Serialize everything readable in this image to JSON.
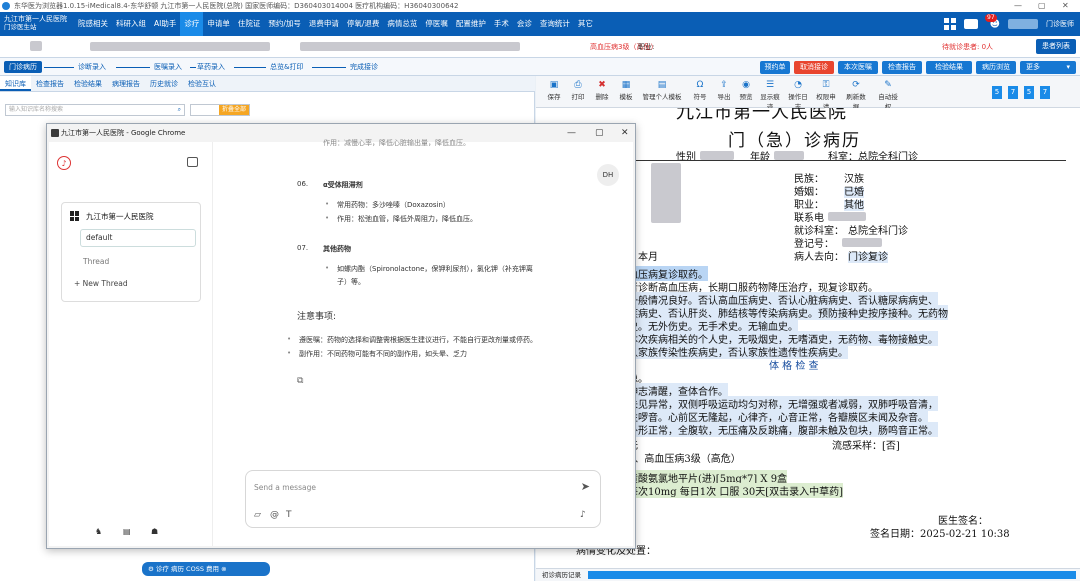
{
  "window": {
    "title": "东华医为浏览器1.0.15-iMedical8.4-东华舒顿 九江市第一人民医院(总院) 国家医师编码：D360403014004 医疗机构编码：H36040300642"
  },
  "menubar": {
    "logo_title": "九江市第一人民医院",
    "logo_sub": "门诊医生站",
    "items": [
      "院感相关",
      "科研入组",
      "AI助手",
      "诊疗",
      "申请单",
      "住院证",
      "预约/加号",
      "退费申请",
      "停氧/退费",
      "病情总览",
      "停医嘱",
      "配置维护",
      "手术",
      "会诊",
      "查询统计",
      "其它"
    ],
    "active_index": 3,
    "badge_count": "97",
    "user_label": "门诊医师"
  },
  "subbar": {
    "status": "高血压病3级（高危）",
    "job_label": "职业:",
    "waiting": "待就诊患者: 0人",
    "patient_list": "患者列表"
  },
  "flow": {
    "active": "门诊病历",
    "steps": [
      "诊断录入",
      "医嘱录入",
      "草药录入",
      "总览&打印",
      "完成接诊"
    ]
  },
  "flow_buttons": [
    "预约单",
    "取消接诊",
    "本次医嘱",
    "检查报告",
    "检验结果",
    "病历浏览",
    "更多"
  ],
  "left_tabs": [
    "知识库",
    "检查报告",
    "检验结果",
    "病理报告",
    "历史就诊",
    "检验互认"
  ],
  "left_search": {
    "placeholder": "输入知识库名称搜索",
    "toggle": "折叠全部"
  },
  "doc_toolbar": [
    "保存",
    "打印",
    "删除",
    "模板",
    "管理个人模板",
    "符号",
    "导出",
    "预览",
    "显示痕迹",
    "操作日志",
    "权限申请",
    "刷新数据",
    "自动授权"
  ],
  "doc_pages": [
    "5",
    "7",
    "5",
    "7"
  ],
  "doc": {
    "h1": "九江市第一人民医院",
    "h2": "门（急）诊病历",
    "gender_label": "性别",
    "age_label": "年龄",
    "dept": "科室：总院全科门诊",
    "nation_label": "民族：",
    "nation": "汉族",
    "marital_label": "婚姻：",
    "marital": "已婚",
    "job_label": "职业：",
    "job": "其他",
    "contact_label": "联系电",
    "clinic_label": "就诊科室：",
    "clinic": "总院全科门诊",
    "reg_label": "登记号：",
    "dest_label": "病人去向：",
    "dest": "门诊复诊",
    "l1": "：本月",
    "l2": "血压病复诊取药。",
    "l3": "者诊断高血压病，长期口服药物降压治疗，现复诊取药。",
    "l4": "一般情况良好。否认高血压病史、否认心脏病病史、否认糖尿病病史、",
    "l5": "疾病史、否认肝炎、肺结核等传染病病史。预防接种史按序接种。无药物",
    "l6": "史。无外伤史。无手术史。无输血史。",
    "l7": "本次疾病相关的个人史，无吸烟史，无嗜酒史，无药物、毒物接触史。",
    "l8": "认家族传染性疾病史，否认家族性遗传性疾病史。",
    "l9": "体 格 检 查",
    "l10": "稳。",
    "l11": "神志清醒，查体合作。",
    "l12": "未见异常，双侧呼吸运动均匀对称，无增强或者减弱，双肺呼吸音清，",
    "l13": "性啰音。心前区无隆起，心律齐，心音正常，各瓣膜区未闻及杂音。",
    "l14": "外形正常，全腹软，无压痛及反跳痛，腹部未触及包块，肠鸣音正常。",
    "l15": "无",
    "flu": "流感采样：[否]",
    "l16": "1、高血压病3级（高危）",
    "l17": "黄酸氨氯地平片(进)[5mg*7] X 9盒",
    "l18": "每次10mg  每日1次  口服  30天[双击录入中草药]",
    "sig": "医生签名：",
    "date": "签名日期：2025-02-21 10:38",
    "change": "病情变化及处置：",
    "foot": "初诊病历记录"
  },
  "chrome": {
    "title": "九江市第一人民医院 - Google Chrome",
    "workspace": "九江市第一人民医院",
    "default_thread": "default",
    "thread_label": "Thread",
    "new_thread": "New Thread",
    "avatar": "DH",
    "item06_no": "06.",
    "item06_title": "α受体阻滞剂",
    "item06_drug": "常用药物：多沙唑嗪（Doxazosin）",
    "item06_effect": "作用：松弛血管，降低外周阻力，降低血压。",
    "item07_no": "07.",
    "item07_title": "其他药物",
    "item07_text_a": "如螺内酯（Spironolactone，保钾利尿剂），氯化钾（补充钾离",
    "item07_text_b": "子）等。",
    "top_cut": "作用：减慢心率，降低心脏输出量，降低血压。",
    "notes_title": "注意事项:",
    "note1": "遵医嘱：药物的选择和调整需根据医生建议进行，不能自行更改剂量或停药。",
    "note2": "副作用：不同药物可能有不同的副作用，如头晕、乏力",
    "input_placeholder": "Send a message"
  },
  "bottom_bar": "诊疗  病历  COSS  费用"
}
